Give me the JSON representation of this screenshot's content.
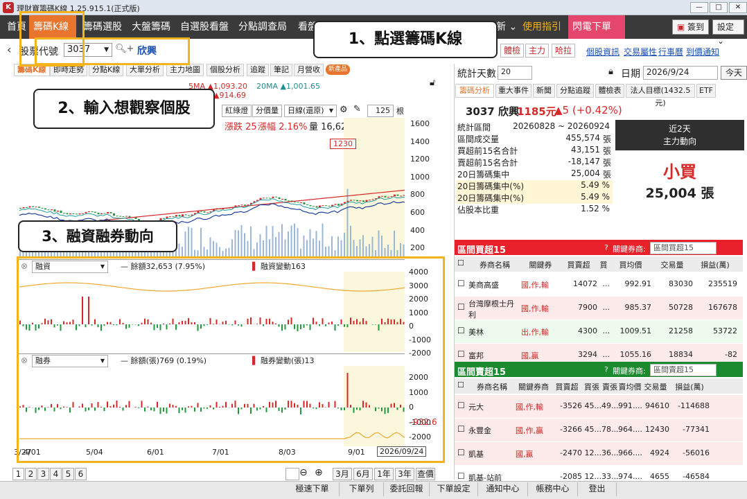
{
  "app": {
    "title": "理財寶籌碼K線 1.25.915.1(正式版)",
    "icon": "K"
  },
  "nav": {
    "items": [
      "首頁",
      "籌碼K線",
      "籌碼選股",
      "大盤籌碼",
      "自選股看盤",
      "分點調查局",
      "看盤"
    ],
    "more": "新 ⌄",
    "guide": "使用指引",
    "flash": "閃電下單 ⌄",
    "signin": "簽到",
    "settings": "設定"
  },
  "stock": {
    "label": "股票代號",
    "code": "3037",
    "name": "欣興"
  },
  "toolbar_tags": [
    "體檢",
    "主力",
    "哈拉"
  ],
  "toolbar_links": [
    "個股資訊",
    "交易屬性",
    "行事曆",
    "到價通知"
  ],
  "subtabs": [
    "籌碼K線",
    "即時走勢",
    "分點K線",
    "大單分析",
    "主力地圖",
    "個股分析",
    "追蹤",
    "筆記",
    "月營收"
  ],
  "new_badge": "新產品",
  "ma": {
    "ma5": "5MA ▲1,093.20",
    "ma20": "20MA ▲1,001.65",
    "ma60": "▲914.69"
  },
  "chart_controls": {
    "ma_sel": "紅綠燈",
    "vol_sel": "分價量",
    "freq": "日線(還原)",
    "count": "125",
    "count_unit": "根"
  },
  "price_info": {
    "change": "漲跌 25",
    "pct": "漲幅 2.16%",
    "vol": "量 16,628"
  },
  "price_tag": "1230",
  "price_axis": [
    "1600",
    "1400",
    "1200",
    "1000",
    "800",
    "600",
    "400",
    "200"
  ],
  "margin": {
    "sel": "融資",
    "balance": "餘額32,653 (7.95%)",
    "change": "融資變動163",
    "axis": [
      "4000",
      "3000",
      "2000",
      "1000",
      "0",
      "-1000",
      "-2000"
    ]
  },
  "short": {
    "sel": "融券",
    "balance": "餘額(張)769 (0.19%)",
    "change": "融券變動(張)13",
    "axis": [
      "2000",
      "1000",
      "0",
      "-1000",
      "-2000"
    ],
    "current": "-932.6"
  },
  "date_axis": [
    "3/27",
    "4/01",
    "5/04",
    "6/01",
    "7/01",
    "8/03",
    "9/01"
  ],
  "date_cursor": "2026/09/24",
  "pager": [
    "1",
    "2",
    "3",
    "4",
    "5",
    "6"
  ],
  "ranges": [
    "3月",
    "6月",
    "1年",
    "3年",
    "查價"
  ],
  "right": {
    "stat_label": "統計天數",
    "stat_days": "20",
    "date_label": "日期",
    "date": "2026/9/24",
    "today": "今天",
    "tabs": [
      "籌碼分析",
      "重大事件",
      "新聞",
      "分點追蹤",
      "體檢表",
      "法人目標(1432.5元)",
      "ETF"
    ],
    "quote": {
      "code_name": "3037 欣興",
      "price": "1185元",
      "chg": "▲5 (+0.42%)"
    },
    "stats": [
      [
        "統計區間",
        "20260828 ~ 20260924",
        ""
      ],
      [
        "區間成交量",
        "455,574",
        "張"
      ],
      [
        "買超前15名合計",
        "43,151",
        "張"
      ],
      [
        "賣超前15名合計",
        "-18,147",
        "張"
      ],
      [
        "20日籌碼集中",
        "25,004",
        "張"
      ],
      [
        "20日籌碼集中(%)",
        "5.49 %",
        ""
      ],
      [
        "20日籌碼集中(%)",
        "5.49 %",
        ""
      ],
      [
        "佔股本比重",
        "1.52 %",
        ""
      ]
    ],
    "main_force": {
      "days": "近2天",
      "title": "主力動向",
      "action": "小買",
      "amount": "25,004 張"
    },
    "buy": {
      "title": "區間買超15",
      "key_label": "關鍵券商:",
      "key_sel": "區間買超15",
      "headers": [
        "券商名稱",
        "關鍵券",
        "買賣超",
        "買",
        "買均價",
        "交易量",
        "損益(萬)"
      ],
      "rows": [
        [
          "美商高盛",
          "國,作,輸",
          "14072",
          "...",
          "992.91",
          "83030",
          "235519"
        ],
        [
          "台灣摩根士丹利",
          "國,作,輸",
          "7900",
          "...",
          "985.37",
          "50728",
          "167678"
        ],
        [
          "美林",
          "出,作,輸",
          "4300",
          "...",
          "1009.51",
          "21258",
          "53722"
        ],
        [
          "富邦",
          "國,贏",
          "3294",
          "...",
          "1055.16",
          "18834",
          "-82"
        ]
      ]
    },
    "sell": {
      "title": "區間賣超15",
      "key_label": "關鍵券商:",
      "key_sel": "區間賣超15",
      "headers": [
        "券商名稱",
        "關鍵券商",
        "買賣超",
        "買張",
        "賣張",
        "賣均價",
        "交易量",
        "損益(萬)"
      ],
      "rows": [
        [
          "元大",
          "國,作,輸",
          "-3526",
          "45...",
          "49...",
          "991....",
          "94610",
          "-114688"
        ],
        [
          "永豐金",
          "國,作,贏",
          "-3266",
          "45...",
          "78...",
          "964....",
          "12430",
          "-77341"
        ],
        [
          "凱基",
          "國,贏",
          "-2470",
          "12...",
          "36...",
          "966....",
          "4924",
          "-56016"
        ],
        [
          "凱基-站前",
          "",
          "-2085",
          "12...",
          "33...",
          "974....",
          "4655",
          "-46584"
        ]
      ]
    }
  },
  "bottom": [
    "極速下單",
    "下單列",
    "委託回報",
    "下單設定",
    "通知中心",
    "帳務中心",
    "登出"
  ],
  "callouts": {
    "c1": "1、點選籌碼K線",
    "c2": "2、輸入想觀察個股",
    "c3": "3、融資融券動向"
  },
  "colors": {
    "up": "#d62828",
    "down": "#1f9a3b",
    "orange": "#e8742e",
    "yellow": "#f5b31a",
    "buyhead": "#e8202a",
    "sellhead": "#1b8a2e"
  }
}
